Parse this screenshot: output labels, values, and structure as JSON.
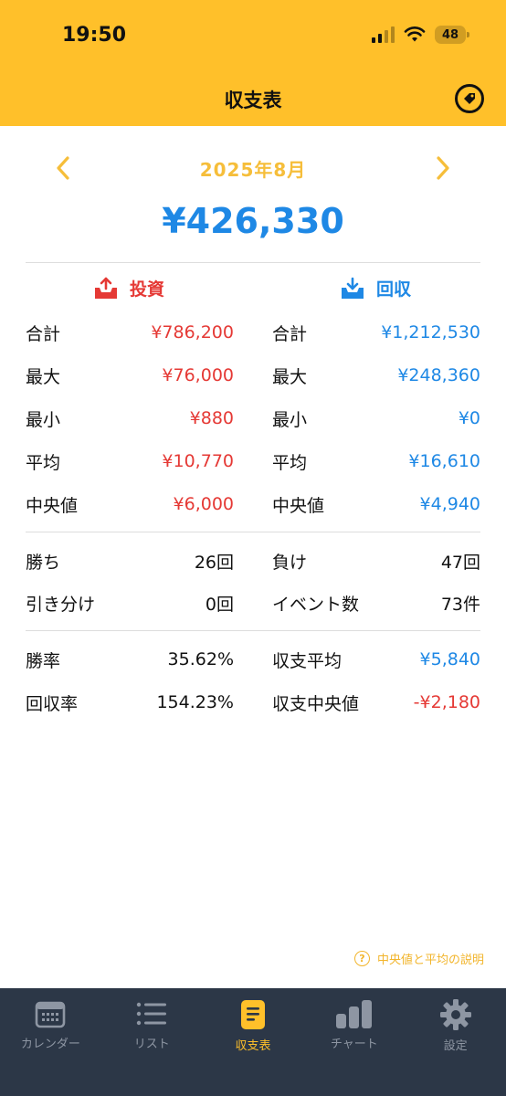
{
  "status_bar": {
    "time": "19:50",
    "battery": "48"
  },
  "nav": {
    "title": "収支表"
  },
  "month": {
    "label": "2025年8月"
  },
  "total": "¥426,330",
  "columns": {
    "invest_title": "投資",
    "recover_title": "回収"
  },
  "invest": [
    {
      "label": "合計",
      "value": "¥786,200"
    },
    {
      "label": "最大",
      "value": "¥76,000"
    },
    {
      "label": "最小",
      "value": "¥880"
    },
    {
      "label": "平均",
      "value": "¥10,770"
    },
    {
      "label": "中央値",
      "value": "¥6,000"
    }
  ],
  "recover": [
    {
      "label": "合計",
      "value": "¥1,212,530"
    },
    {
      "label": "最大",
      "value": "¥248,360"
    },
    {
      "label": "最小",
      "value": "¥0"
    },
    {
      "label": "平均",
      "value": "¥16,610"
    },
    {
      "label": "中央値",
      "value": "¥4,940"
    }
  ],
  "record": {
    "wins_label": "勝ち",
    "wins_value": "26回",
    "losses_label": "負け",
    "losses_value": "47回",
    "draws_label": "引き分け",
    "draws_value": "0回",
    "events_label": "イベント数",
    "events_value": "73件"
  },
  "rates": {
    "win_rate_label": "勝率",
    "win_rate_value": "35.62%",
    "balance_avg_label": "収支平均",
    "balance_avg_value": "¥5,840",
    "recovery_rate_label": "回収率",
    "recovery_rate_value": "154.23%",
    "balance_median_label": "収支中央値",
    "balance_median_value": "-¥2,180"
  },
  "help": {
    "label": "中央値と平均の説明"
  },
  "tabs": [
    {
      "label": "カレンダー",
      "icon": "calendar-icon"
    },
    {
      "label": "リスト",
      "icon": "list-icon"
    },
    {
      "label": "収支表",
      "icon": "document-icon"
    },
    {
      "label": "チャート",
      "icon": "bar-chart-icon"
    },
    {
      "label": "設定",
      "icon": "gear-icon"
    }
  ],
  "colors": {
    "accent": "#FFC02A",
    "invest": "#E53935",
    "recover": "#1E88E5",
    "tabbar": "#2C3747"
  }
}
